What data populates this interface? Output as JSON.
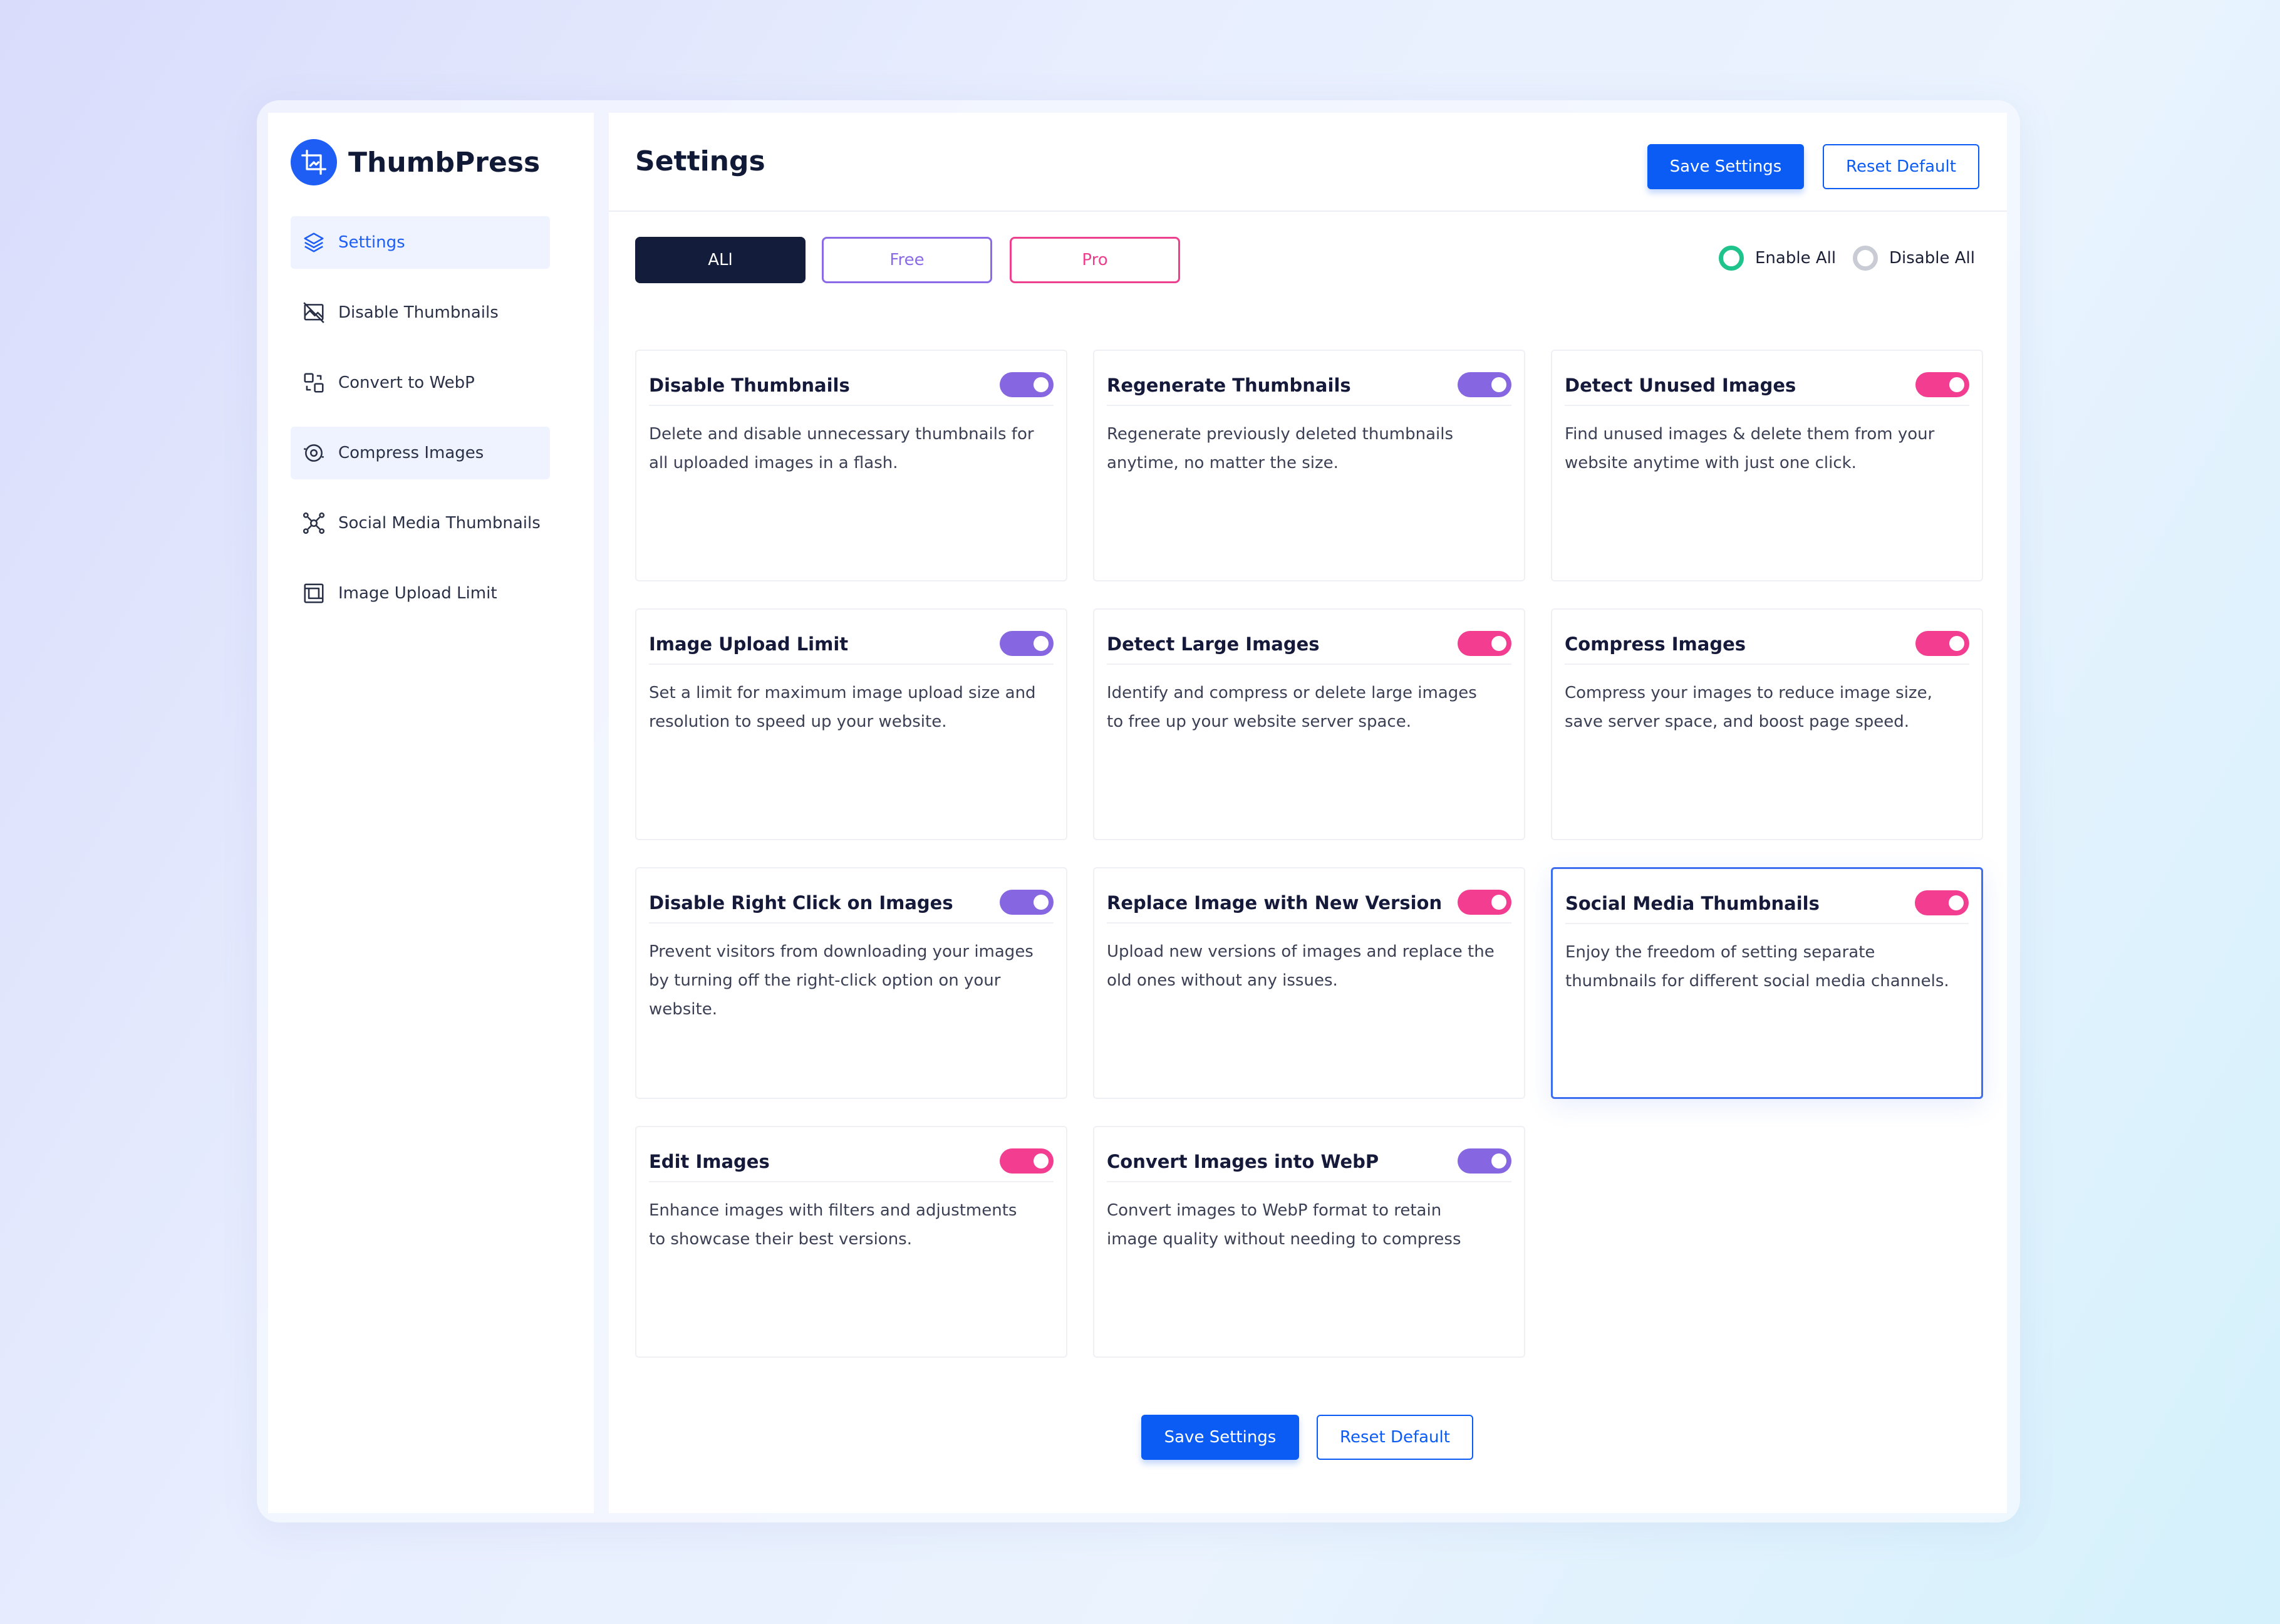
{
  "brand": {
    "name": "ThumbPress",
    "color": "#1e5ef5",
    "icon": "crop-image-icon"
  },
  "sidebar": {
    "items": [
      {
        "label": "Settings",
        "icon": "layers-icon",
        "active": true
      },
      {
        "label": "Disable Thumbnails",
        "icon": "image-off-icon"
      },
      {
        "label": "Convert to WebP",
        "icon": "convert-icon"
      },
      {
        "label": "Compress Images",
        "icon": "compress-icon",
        "highlighted": true
      },
      {
        "label": "Social Media Thumbnails",
        "icon": "share-nodes-icon"
      },
      {
        "label": "Image Upload Limit",
        "icon": "upload-limit-icon"
      }
    ]
  },
  "header": {
    "title": "Settings",
    "save_label": "Save Settings",
    "reset_label": "Reset Default"
  },
  "filters": {
    "all": "ALl",
    "free": "Free",
    "pro": "Pro",
    "selected": "ALl"
  },
  "toggles": {
    "enable_all": "Enable All",
    "disable_all": "Disable All",
    "selected": "Enable All"
  },
  "cards": [
    {
      "title": "Disable Thumbnails",
      "desc": "Delete and disable unnecessary thumbnails for all uploaded images in a flash.",
      "tier": "free",
      "enabled": true
    },
    {
      "title": "Regenerate Thumbnails",
      "desc": "Regenerate previously deleted thumbnails anytime, no matter the size.",
      "tier": "free",
      "enabled": true
    },
    {
      "title": "Detect Unused Images",
      "desc": "Find unused images & delete them from your website anytime with just one click.",
      "tier": "pro",
      "enabled": true
    },
    {
      "title": "Image Upload Limit",
      "desc": "Set a limit for maximum image upload size and resolution to speed up your website.",
      "tier": "free",
      "enabled": true
    },
    {
      "title": "Detect Large Images",
      "desc": "Identify and compress or delete large images to free up your website server space.",
      "tier": "pro",
      "enabled": true
    },
    {
      "title": "Compress Images",
      "desc": "Compress your images to reduce image size, save server space, and boost page speed.",
      "tier": "pro",
      "enabled": true
    },
    {
      "title": "Disable Right Click on Images",
      "desc": "Prevent visitors from downloading your images by turning off the right-click option on your website.",
      "tier": "free",
      "enabled": true
    },
    {
      "title": "Replace Image with New Version",
      "desc": "Upload new versions of images and replace the old ones without any issues.",
      "tier": "pro",
      "enabled": true
    },
    {
      "title": "Social Media Thumbnails",
      "desc": "Enjoy the freedom of setting separate thumbnails for different social media channels.",
      "tier": "pro",
      "enabled": true,
      "selected": true
    },
    {
      "title": "Edit Images",
      "desc": "Enhance images with filters and adjustments to showcase their best versions.",
      "tier": "pro",
      "enabled": true
    },
    {
      "title": "Convert Images into WebP",
      "desc": "Convert images to WebP format to retain image quality without needing to compress",
      "tier": "free",
      "enabled": true
    }
  ],
  "footer": {
    "save_label": "Save Settings",
    "reset_label": "Reset Default"
  },
  "colors": {
    "primary": "#0b5cf5",
    "free_accent": "#8767e1",
    "pro_accent": "#f23d90",
    "enable_radio": "#1fc38c",
    "dark": "#141c3c"
  }
}
